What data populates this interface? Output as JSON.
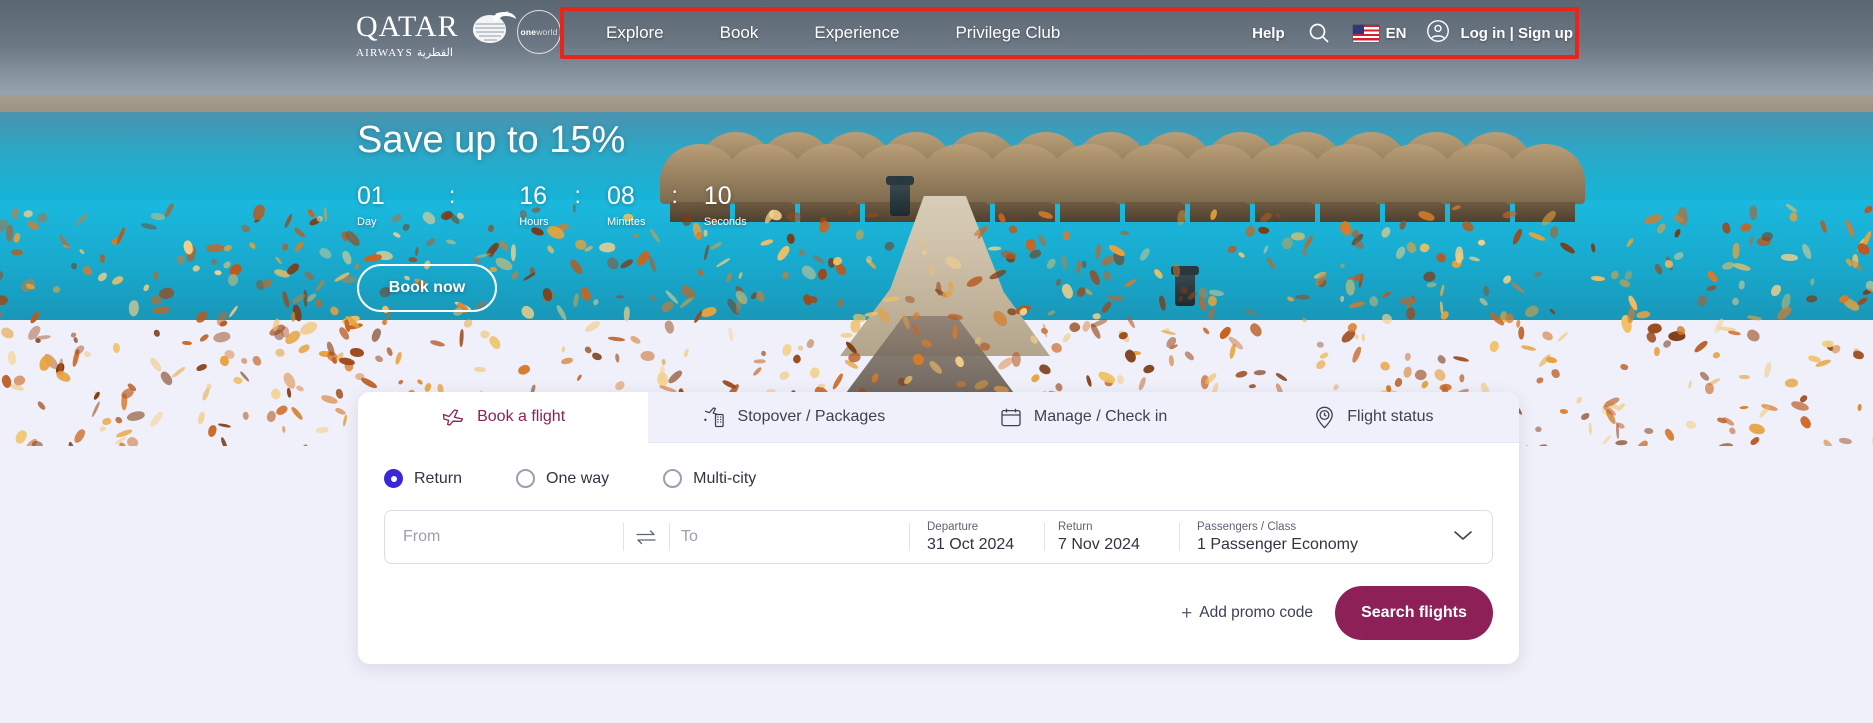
{
  "brand": {
    "name": "QATAR",
    "tagline": "AIRWAYS",
    "arabic": "القطرية",
    "alliance": "oneworld",
    "alliance_bold": "one",
    "alliance_light": "world",
    "accent_burgundy": "#8D2157",
    "accent_red_box": "#E8241B",
    "radio_blue": "#3A27D8",
    "page_bg": "#F0F0FA"
  },
  "nav": {
    "links": [
      {
        "label": "Explore",
        "name": "nav-link-explore"
      },
      {
        "label": "Book",
        "name": "nav-link-book"
      },
      {
        "label": "Experience",
        "name": "nav-link-experience"
      },
      {
        "label": "Privilege Club",
        "name": "nav-link-privilege-club"
      }
    ],
    "help": "Help",
    "search_icon": "search-icon",
    "language": "EN",
    "flag_icon": "us-flag-icon",
    "account_icon": "account-circle-icon",
    "account": "Log in | Sign up"
  },
  "hero": {
    "title": "Save up to 15%",
    "countdown": [
      {
        "value": "01",
        "label": "Day"
      },
      {
        "value": "16",
        "label": "Hours"
      },
      {
        "value": "08",
        "label": "Minutes"
      },
      {
        "value": "10",
        "label": "Seconds"
      }
    ],
    "separator": ":",
    "cta": "Book now"
  },
  "widget": {
    "tabs": [
      {
        "label": "Book a flight",
        "icon": "airplane-icon",
        "active": true
      },
      {
        "label": "Stopover / Packages",
        "icon": "stopover-hotel-icon",
        "active": false
      },
      {
        "label": "Manage / Check in",
        "icon": "calendar-icon",
        "active": false
      },
      {
        "label": "Flight status",
        "icon": "location-pin-clock-icon",
        "active": false
      }
    ],
    "trip_types": [
      {
        "label": "Return",
        "selected": true
      },
      {
        "label": "One way",
        "selected": false
      },
      {
        "label": "Multi-city",
        "selected": false
      }
    ],
    "search": {
      "from_placeholder": "From",
      "to_placeholder": "To",
      "swap_icon": "swap-arrows-icon",
      "departure_label": "Departure",
      "departure_value": "31 Oct 2024",
      "return_label": "Return",
      "return_value": "7 Nov 2024",
      "passengers_label": "Passengers / Class",
      "passengers_value": "1  Passenger Economy",
      "chevron_icon": "chevron-down-icon"
    },
    "promo": "Add promo code",
    "promo_plus": "+",
    "search_button": "Search flights"
  }
}
